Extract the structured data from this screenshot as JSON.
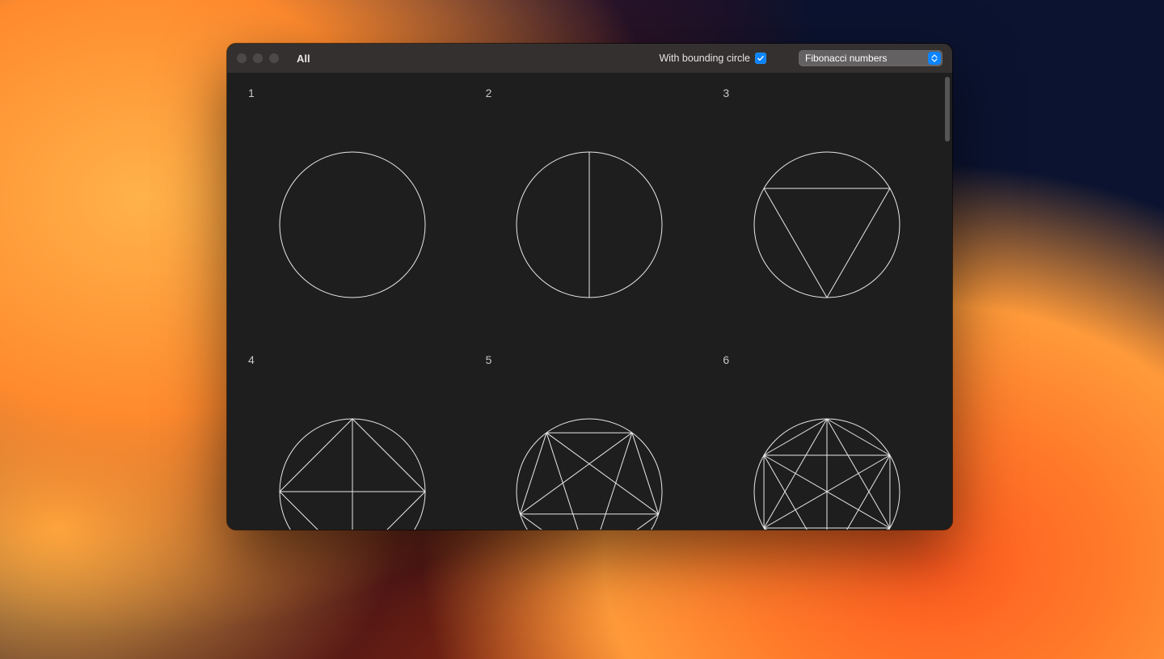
{
  "window": {
    "title": "All"
  },
  "toolbar": {
    "bounding_label": "With bounding circle",
    "bounding_checked": true,
    "series_select": {
      "value": "Fibonacci numbers"
    }
  },
  "grid": {
    "bounding_circle": true,
    "cells": [
      {
        "label": "1",
        "n": 1
      },
      {
        "label": "2",
        "n": 2
      },
      {
        "label": "3",
        "n": 3
      },
      {
        "label": "4",
        "n": 4
      },
      {
        "label": "5",
        "n": 5
      },
      {
        "label": "6",
        "n": 6
      }
    ]
  }
}
